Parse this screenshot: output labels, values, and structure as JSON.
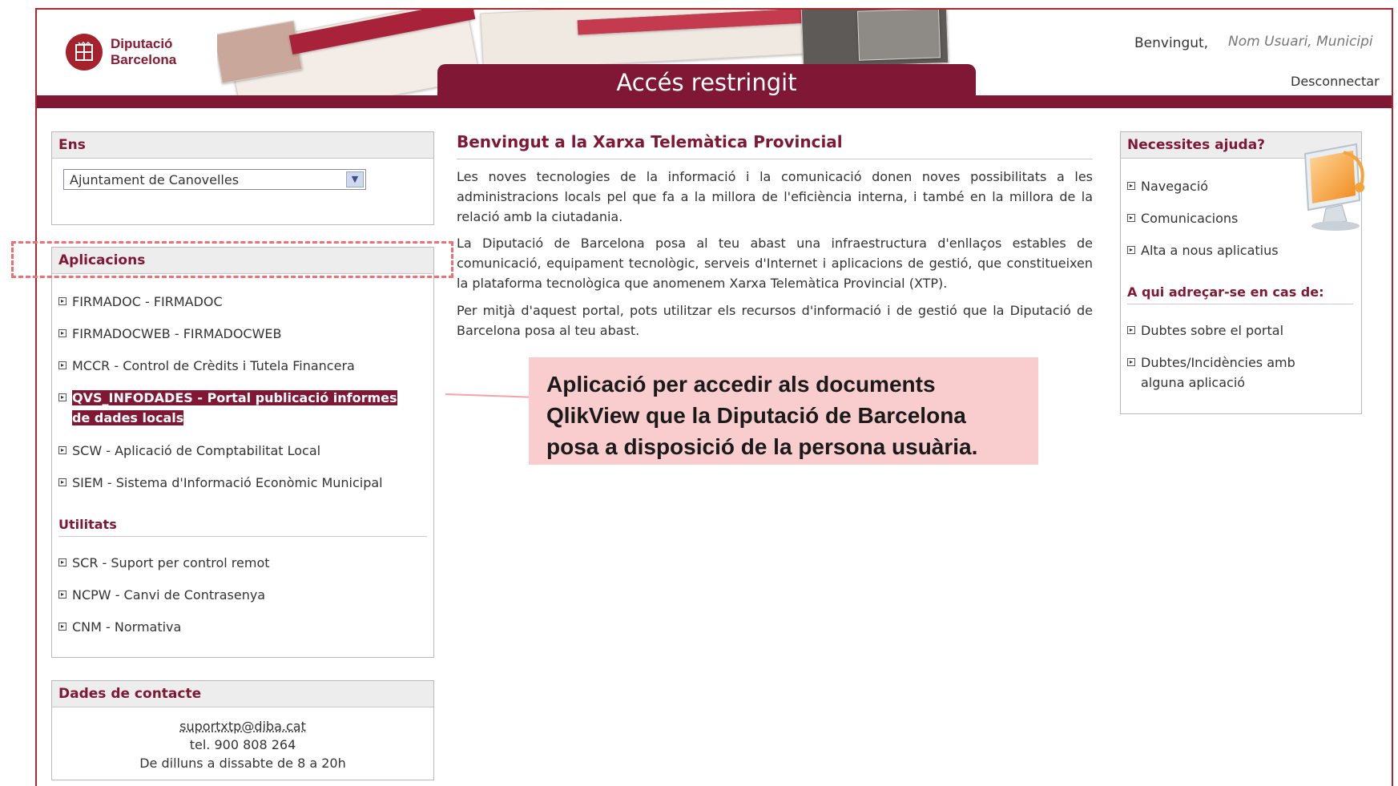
{
  "header": {
    "logo_line1": "Diputació",
    "logo_line2": "Barcelona",
    "title": "Accés restringit",
    "welcome": "Benvingut,",
    "user_placeholder": "Nom Usuari, Municipi",
    "logout": "Desconnectar"
  },
  "ens": {
    "heading": "Ens",
    "selected": "Ajuntament de Canovelles"
  },
  "apps": {
    "heading": "Aplicacions",
    "items": [
      "FIRMADOC - FIRMADOC",
      "FIRMADOCWEB - FIRMADOCWEB",
      "MCCR - Control de Crèdits i Tutela Financera",
      "QVS_INFODADES - Portal publicació informes",
      "de dades locals",
      "SCW - Aplicació de Comptabilitat Local",
      "SIEM - Sistema d'Informació Econòmic Municipal"
    ],
    "utilities_heading": "Utilitats",
    "utilities": [
      "SCR - Suport per control remot",
      "NCPW - Canvi de Contrasenya",
      "CNM - Normativa"
    ]
  },
  "contact": {
    "heading": "Dades de contacte",
    "email": "suportxtp@diba.cat",
    "phone": "tel. 900 808 264",
    "hours": "De dilluns a dissabte de 8 a 20h"
  },
  "main": {
    "title": "Benvingut a la Xarxa Telemàtica Provincial",
    "p1": "Les noves tecnologies de la informació i la comunicació donen noves possibilitats a les administracions locals pel que fa a la millora de l'eficiència interna, i també en la millora de la relació amb la ciutadania.",
    "p2": "La Diputació de Barcelona posa al teu abast una infraestructura d'enllaços estables de comunicació, equipament tecnològic, serveis d'Internet i aplicacions de gestió, que constitueixen la plataforma tecnològica que anomenem Xarxa Telemàtica Provincial (XTP).",
    "p3": "Per mitjà d'aquest portal, pots utilitzar els recursos d'informació i de gestió que la Diputació de Barcelona posa al teu abast."
  },
  "callout": {
    "text": "Aplicació per accedir als documents QlikView que la Diputació de Barcelona posa a disposició de la persona usuària."
  },
  "help": {
    "heading": "Necessites ajuda?",
    "items": [
      "Navegació",
      "Comunicacions",
      "Alta a nous aplicatius"
    ],
    "contact_heading": "A qui adreçar-se en cas de:",
    "contact_items": [
      "Dubtes sobre el portal",
      "Dubtes/Incidències amb",
      "alguna aplicació"
    ]
  },
  "colors": {
    "brand": "#7f1735",
    "callout_bg": "#f9cccd",
    "dash": "#ef6e73"
  }
}
